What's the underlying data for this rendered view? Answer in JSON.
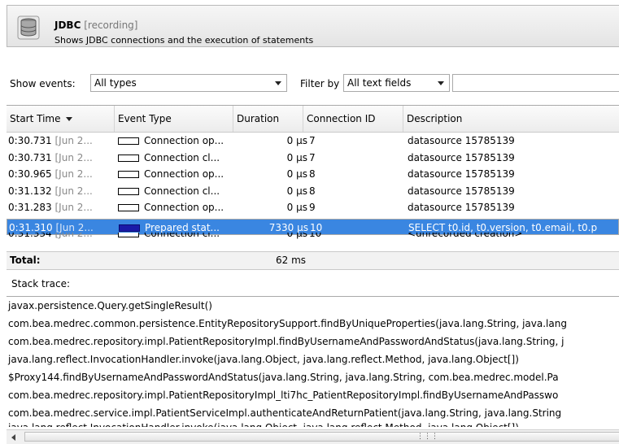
{
  "header": {
    "title": "JDBC",
    "status": "[recording]",
    "subtitle": "Shows JDBC connections and the execution of statements",
    "icon": "database-icon"
  },
  "filter": {
    "show_events_label": "Show events:",
    "show_events_value": "All types",
    "filter_by_label": "Filter by",
    "filter_by_value": "All text fields",
    "search_value": ""
  },
  "table": {
    "columns": [
      "Start Time",
      "Event Type",
      "Duration",
      "Connection ID",
      "Description"
    ],
    "rows": [
      {
        "time": "0:30.731",
        "date": "[Jun 2...",
        "type": "Connection op...",
        "duration": "0 µs",
        "conn": "7",
        "desc": "datasource 15785139",
        "icon": "connection-event-icon"
      },
      {
        "time": "0:30.731",
        "date": "[Jun 2...",
        "type": "Connection cl...",
        "duration": "0 µs",
        "conn": "7",
        "desc": "datasource 15785139",
        "icon": "connection-event-icon"
      },
      {
        "time": "0:30.965",
        "date": "[Jun 2...",
        "type": "Connection op...",
        "duration": "0 µs",
        "conn": "8",
        "desc": "datasource 15785139",
        "icon": "connection-event-icon"
      },
      {
        "time": "0:31.132",
        "date": "[Jun 2...",
        "type": "Connection cl...",
        "duration": "0 µs",
        "conn": "8",
        "desc": "datasource 15785139",
        "icon": "connection-event-icon"
      },
      {
        "time": "0:31.283",
        "date": "[Jun 2...",
        "type": "Connection op...",
        "duration": "0 µs",
        "conn": "9",
        "desc": "datasource 15785139",
        "icon": "connection-event-icon"
      },
      {
        "time": "0:31.310",
        "date": "[Jun 2...",
        "type": "Prepared stat...",
        "duration": "7330 µs",
        "conn": "10",
        "desc": "SELECT t0.id, t0.version, t0.email, t0.p",
        "icon": "statement-event-icon"
      },
      {
        "time": "0:31.334",
        "date": "[Jun 2...",
        "type": "Connection cl...",
        "duration": "0 µs",
        "conn": "10",
        "desc": "<unrecorded creation>",
        "icon": "connection-event-icon"
      }
    ],
    "selected_index": 5,
    "total_label": "Total:",
    "total_value": "62 ms"
  },
  "stack": {
    "label": "Stack trace:",
    "lines": [
      "javax.persistence.Query.getSingleResult()",
      "com.bea.medrec.common.persistence.EntityRepositorySupport.findByUniqueProperties(java.lang.String, java.lang",
      "com.bea.medrec.repository.impl.PatientRepositoryImpl.findByUsernameAndPasswordAndStatus(java.lang.String, j",
      "java.lang.reflect.InvocationHandler.invoke(java.lang.Object, java.lang.reflect.Method, java.lang.Object[])",
      "$Proxy144.findByUsernameAndPasswordAndStatus(java.lang.String, java.lang.String, com.bea.medrec.model.Pa",
      "com.bea.medrec.repository.impl.PatientRepositoryImpl_lti7hc_PatientRepositoryImpl.findByUsernameAndPasswo",
      "com.bea.medrec.service.impl.PatientServiceImpl.authenticateAndReturnPatient(java.lang.String, java.lang.String",
      "java.lang.reflect.InvocationHandler.invoke(java.lang.Object, java.lang.reflect.Method, java.lang.Object[])"
    ]
  },
  "colors": {
    "selection": "#3a86e1",
    "statement_icon": "#1a1aa8"
  }
}
